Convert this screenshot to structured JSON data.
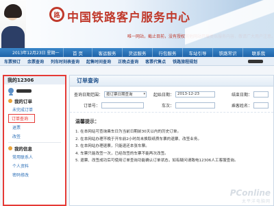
{
  "header": {
    "logo_glyph": "路",
    "site_title": "中国铁路客户服务中心",
    "notice": "唯一网站，截止目前，没有授权其他网站开展类似服务内容，敬请广大用户注意。",
    "date_text": "2013年12月23日 星期一",
    "colors": {
      "title_red": "#c0392b",
      "nav_blue": "#1f63a8"
    }
  },
  "main_nav": [
    {
      "label": "首 页"
    },
    {
      "label": "客运服务"
    },
    {
      "label": "货运服务"
    },
    {
      "label": "行包服务"
    },
    {
      "label": "车站引导"
    },
    {
      "label": "铁路常识"
    },
    {
      "label": "联系我"
    }
  ],
  "sub_nav": [
    {
      "label": "车票预订"
    },
    {
      "label": "余票查询"
    },
    {
      "label": "列车时刻表查询"
    },
    {
      "label": "起售时间查询"
    },
    {
      "label": "正晚点查询"
    },
    {
      "label": "客票代售点"
    },
    {
      "label": "铁路旅程规划"
    }
  ],
  "sidebar": {
    "title": "我的12306",
    "sections": [
      {
        "title": "我的订单",
        "icon": "order-icon",
        "links": [
          {
            "label": "未完成订单",
            "active": false
          },
          {
            "label": "订单查询",
            "active": true
          },
          {
            "label": "退票",
            "active": false
          },
          {
            "label": "改签",
            "active": false
          }
        ]
      },
      {
        "title": "我的信息",
        "icon": "info-icon",
        "links": [
          {
            "label": "常用联系人",
            "active": false
          },
          {
            "label": "个人资料",
            "active": false
          },
          {
            "label": "密码修改",
            "active": false
          }
        ]
      }
    ]
  },
  "panel": {
    "title": "订单查询",
    "form": {
      "query_date_label": "查询日期范围：",
      "query_date_value": "按订票日期查询",
      "start_date_label": "起始日期：",
      "start_date_value": "2013-12-23",
      "end_date_label": "结束日期：",
      "end_date_value": "",
      "order_no_label": "订单号：",
      "order_no_value": "",
      "train_no_label": "车次：",
      "train_no_value": "",
      "passenger_label": "乘客姓名：",
      "passenger_value": ""
    },
    "tips_title": "温馨提示：",
    "tips": [
      "1. 在本网站可查询乘车日为当前日期前30天以内的历史订单。",
      "2. 在本网站办理不晚于开车前2小时尚未换取纸质车票的退票、改签业务。",
      "3. 在本网站办理退票，只能退还本张车票。",
      "4. 车票只能改签一次，已经改签的车票不能再次改签。",
      "5. 退票、改签成功后可使用订单查询功能确认订单状态，如有疑问请致电12306人工客服查询。"
    ]
  },
  "watermark": {
    "logo": "PConline",
    "text": "太平洋电脑网"
  }
}
